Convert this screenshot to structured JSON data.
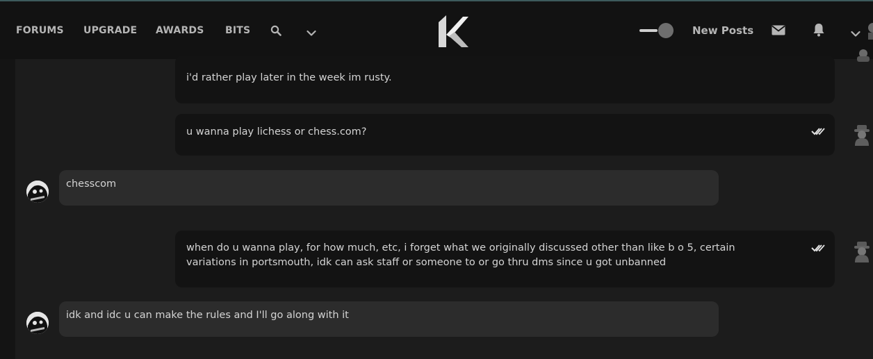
{
  "nav": {
    "links": [
      "FORUMS",
      "UPGRADE",
      "AWARDS",
      "BITS"
    ],
    "new_posts": "New Posts"
  },
  "messages": [
    {
      "from": "me",
      "text": "i'd rather play later in the week im rusty."
    },
    {
      "from": "me",
      "text": "u wanna play lichess or chess.com?",
      "read": true
    },
    {
      "from": "other",
      "text": "chesscom"
    },
    {
      "from": "me",
      "text": "when do u wanna play, for how much, etc, i forget what we originally discussed other than like b o 5, certain variations in portsmouth, idk can ask staff or someone to or go thru dms since u got unbanned",
      "read": true
    },
    {
      "from": "other",
      "text": "idk and idc u can make the rules and I'll go along with it"
    }
  ],
  "icons": {
    "search": "search-icon",
    "more_nav": "chevron-down-icon",
    "logo": "k-logo",
    "theme_toggle": "toggle-switch",
    "messages": "envelope-icon",
    "alerts": "bell-icon",
    "user_menu": "chevron-down-icon",
    "read_receipt": "double-check-icon"
  },
  "colors": {
    "background": "#1c1c1c",
    "navbar": "#121212",
    "own_bubble": "#131313",
    "other_bubble": "#2c2c2c",
    "accent_line": "#3d5a5c"
  }
}
